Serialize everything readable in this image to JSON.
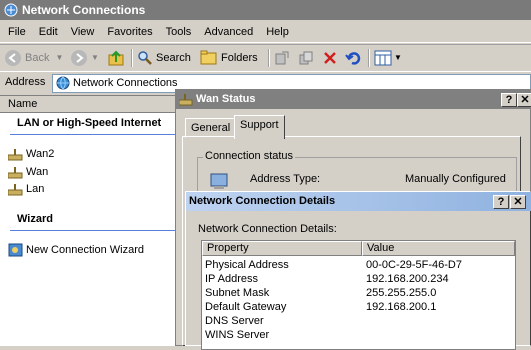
{
  "window": {
    "title": "Network Connections"
  },
  "menu": [
    "File",
    "Edit",
    "View",
    "Favorites",
    "Tools",
    "Advanced",
    "Help"
  ],
  "toolbar": {
    "back": "Back",
    "search": "Search",
    "folders": "Folders"
  },
  "address": {
    "label": "Address",
    "value": "Network Connections"
  },
  "list": {
    "column_name": "Name",
    "group_lan": "LAN or High-Speed Internet",
    "items": [
      "Wan2",
      "Wan",
      "Lan"
    ],
    "group_wizard": "Wizard",
    "wizard_item": "New Connection Wizard"
  },
  "wan_status": {
    "title": "Wan Status",
    "tabs": [
      "General",
      "Support"
    ],
    "group_label": "Connection status",
    "address_type_label": "Address Type:",
    "address_type_value": "Manually Configured"
  },
  "details": {
    "title": "Network Connection Details",
    "subtitle": "Network Connection Details:",
    "col_property": "Property",
    "col_value": "Value",
    "rows": [
      {
        "property": "Physical Address",
        "value": "00-0C-29-5F-46-D7"
      },
      {
        "property": "IP Address",
        "value": "192.168.200.234"
      },
      {
        "property": "Subnet Mask",
        "value": "255.255.255.0"
      },
      {
        "property": "Default Gateway",
        "value": "192.168.200.1"
      },
      {
        "property": "DNS Server",
        "value": ""
      },
      {
        "property": "WINS Server",
        "value": ""
      }
    ]
  },
  "colors": {
    "accent": "#3a6ea5",
    "inactive_title": "#808080"
  }
}
